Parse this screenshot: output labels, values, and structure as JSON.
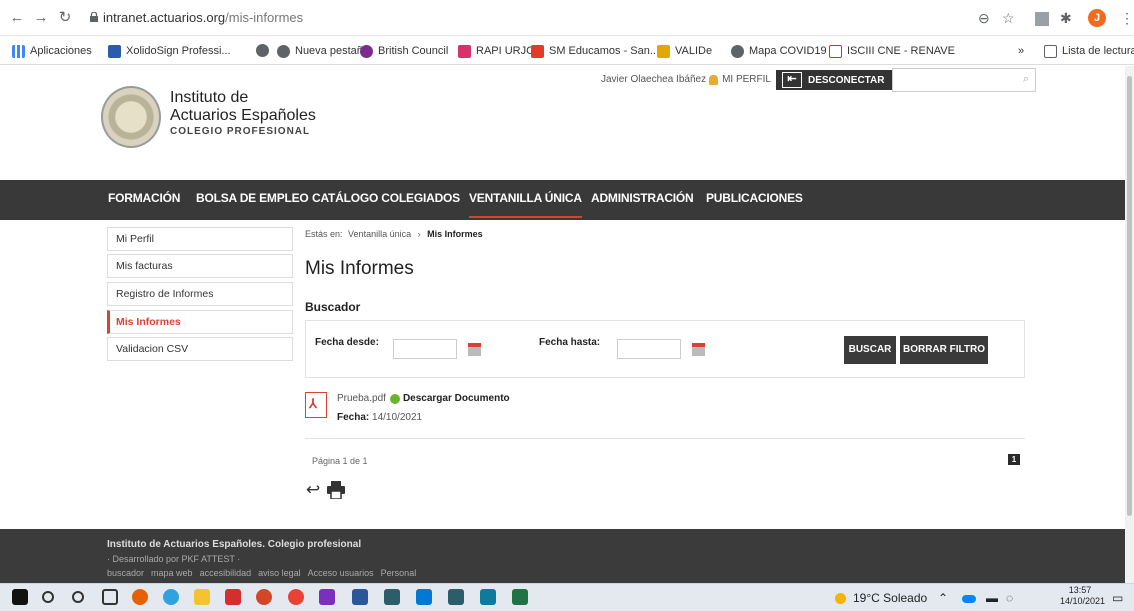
{
  "browser": {
    "url_domain": "intranet.actuarios.org",
    "url_path": "/mis-informes",
    "avatar_letter": "J",
    "bookmarks": [
      {
        "label": "Aplicaciones",
        "color": "#4285f4"
      },
      {
        "label": "XolidoSign Professi...",
        "color": "#2a5caa"
      },
      {
        "label": "",
        "color": "#5f6368"
      },
      {
        "label": "Nueva pestaña",
        "color": "#5f6368"
      },
      {
        "label": "British Council",
        "color": "#7b2d8e"
      },
      {
        "label": "RAPI URJC",
        "color": "#d6336c"
      },
      {
        "label": "SM Educamos - San...",
        "color": "#e23b2b"
      },
      {
        "label": "VALIDe",
        "color": "#e0a800"
      },
      {
        "label": "Mapa COVID19",
        "color": "#5f6368"
      },
      {
        "label": "ISCIII CNE - RENAVE",
        "color": "#c0392b"
      }
    ],
    "reading_list": "Lista de lectura",
    "more": "»"
  },
  "site": {
    "logo_line1": "Instituto de",
    "logo_line2": "Actuarios Españoles",
    "logo_line3": "COLEGIO PROFESIONAL",
    "user_name": "Javier Olaechea Ibáñez",
    "profile_link": "MI PERFIL",
    "logout": "DESCONECTAR",
    "nav": [
      "FORMACIÓN",
      "BOLSA DE EMPLEO",
      "CATÁLOGO COLEGIADOS",
      "VENTANILLA ÚNICA",
      "ADMINISTRACIÓN",
      "PUBLICACIONES"
    ],
    "accent": "#d84230"
  },
  "sidebar": {
    "items": [
      "Mi Perfil",
      "Mis facturas",
      "Registro de Informes",
      "Mis Informes",
      "Validacion CSV"
    ]
  },
  "main": {
    "breadcrumb_prefix": "Estás en:",
    "breadcrumb_parent": "Ventanilla única",
    "breadcrumb_sep": "›",
    "breadcrumb_current": "Mis Informes",
    "title": "Mis Informes",
    "search_heading": "Buscador",
    "from_label": "Fecha desde:",
    "to_label": "Fecha hasta:",
    "search_btn": "BUSCAR",
    "clear_btn": "BORRAR FILTRO",
    "doc_name": "Prueba.pdf",
    "doc_download": "Descargar Documento",
    "doc_date_label": "Fecha:",
    "doc_date": "14/10/2021",
    "page_info": "Página 1 de 1",
    "page_number": "1"
  },
  "footer": {
    "line1": "Instituto de Actuarios Españoles. Colegio profesional",
    "line2": "· Desarrollado por PKF ATTEST ·",
    "links": [
      "buscador",
      "mapa web",
      "accesibilidad",
      "aviso legal",
      "Acceso usuarios",
      "Personal"
    ]
  },
  "taskbar": {
    "weather": "19°C Soleado",
    "time": "13:57",
    "date": "14/10/2021"
  }
}
